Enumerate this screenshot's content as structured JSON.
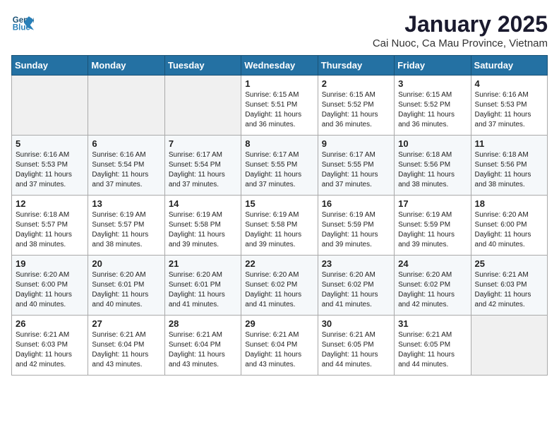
{
  "header": {
    "logo_line1": "General",
    "logo_line2": "Blue",
    "title": "January 2025",
    "subtitle": "Cai Nuoc, Ca Mau Province, Vietnam"
  },
  "weekdays": [
    "Sunday",
    "Monday",
    "Tuesday",
    "Wednesday",
    "Thursday",
    "Friday",
    "Saturday"
  ],
  "weeks": [
    [
      {
        "day": "",
        "info": ""
      },
      {
        "day": "",
        "info": ""
      },
      {
        "day": "",
        "info": ""
      },
      {
        "day": "1",
        "info": "Sunrise: 6:15 AM\nSunset: 5:51 PM\nDaylight: 11 hours\nand 36 minutes."
      },
      {
        "day": "2",
        "info": "Sunrise: 6:15 AM\nSunset: 5:52 PM\nDaylight: 11 hours\nand 36 minutes."
      },
      {
        "day": "3",
        "info": "Sunrise: 6:15 AM\nSunset: 5:52 PM\nDaylight: 11 hours\nand 36 minutes."
      },
      {
        "day": "4",
        "info": "Sunrise: 6:16 AM\nSunset: 5:53 PM\nDaylight: 11 hours\nand 37 minutes."
      }
    ],
    [
      {
        "day": "5",
        "info": "Sunrise: 6:16 AM\nSunset: 5:53 PM\nDaylight: 11 hours\nand 37 minutes."
      },
      {
        "day": "6",
        "info": "Sunrise: 6:16 AM\nSunset: 5:54 PM\nDaylight: 11 hours\nand 37 minutes."
      },
      {
        "day": "7",
        "info": "Sunrise: 6:17 AM\nSunset: 5:54 PM\nDaylight: 11 hours\nand 37 minutes."
      },
      {
        "day": "8",
        "info": "Sunrise: 6:17 AM\nSunset: 5:55 PM\nDaylight: 11 hours\nand 37 minutes."
      },
      {
        "day": "9",
        "info": "Sunrise: 6:17 AM\nSunset: 5:55 PM\nDaylight: 11 hours\nand 37 minutes."
      },
      {
        "day": "10",
        "info": "Sunrise: 6:18 AM\nSunset: 5:56 PM\nDaylight: 11 hours\nand 38 minutes."
      },
      {
        "day": "11",
        "info": "Sunrise: 6:18 AM\nSunset: 5:56 PM\nDaylight: 11 hours\nand 38 minutes."
      }
    ],
    [
      {
        "day": "12",
        "info": "Sunrise: 6:18 AM\nSunset: 5:57 PM\nDaylight: 11 hours\nand 38 minutes."
      },
      {
        "day": "13",
        "info": "Sunrise: 6:19 AM\nSunset: 5:57 PM\nDaylight: 11 hours\nand 38 minutes."
      },
      {
        "day": "14",
        "info": "Sunrise: 6:19 AM\nSunset: 5:58 PM\nDaylight: 11 hours\nand 39 minutes."
      },
      {
        "day": "15",
        "info": "Sunrise: 6:19 AM\nSunset: 5:58 PM\nDaylight: 11 hours\nand 39 minutes."
      },
      {
        "day": "16",
        "info": "Sunrise: 6:19 AM\nSunset: 5:59 PM\nDaylight: 11 hours\nand 39 minutes."
      },
      {
        "day": "17",
        "info": "Sunrise: 6:19 AM\nSunset: 5:59 PM\nDaylight: 11 hours\nand 39 minutes."
      },
      {
        "day": "18",
        "info": "Sunrise: 6:20 AM\nSunset: 6:00 PM\nDaylight: 11 hours\nand 40 minutes."
      }
    ],
    [
      {
        "day": "19",
        "info": "Sunrise: 6:20 AM\nSunset: 6:00 PM\nDaylight: 11 hours\nand 40 minutes."
      },
      {
        "day": "20",
        "info": "Sunrise: 6:20 AM\nSunset: 6:01 PM\nDaylight: 11 hours\nand 40 minutes."
      },
      {
        "day": "21",
        "info": "Sunrise: 6:20 AM\nSunset: 6:01 PM\nDaylight: 11 hours\nand 41 minutes."
      },
      {
        "day": "22",
        "info": "Sunrise: 6:20 AM\nSunset: 6:02 PM\nDaylight: 11 hours\nand 41 minutes."
      },
      {
        "day": "23",
        "info": "Sunrise: 6:20 AM\nSunset: 6:02 PM\nDaylight: 11 hours\nand 41 minutes."
      },
      {
        "day": "24",
        "info": "Sunrise: 6:20 AM\nSunset: 6:02 PM\nDaylight: 11 hours\nand 42 minutes."
      },
      {
        "day": "25",
        "info": "Sunrise: 6:21 AM\nSunset: 6:03 PM\nDaylight: 11 hours\nand 42 minutes."
      }
    ],
    [
      {
        "day": "26",
        "info": "Sunrise: 6:21 AM\nSunset: 6:03 PM\nDaylight: 11 hours\nand 42 minutes."
      },
      {
        "day": "27",
        "info": "Sunrise: 6:21 AM\nSunset: 6:04 PM\nDaylight: 11 hours\nand 43 minutes."
      },
      {
        "day": "28",
        "info": "Sunrise: 6:21 AM\nSunset: 6:04 PM\nDaylight: 11 hours\nand 43 minutes."
      },
      {
        "day": "29",
        "info": "Sunrise: 6:21 AM\nSunset: 6:04 PM\nDaylight: 11 hours\nand 43 minutes."
      },
      {
        "day": "30",
        "info": "Sunrise: 6:21 AM\nSunset: 6:05 PM\nDaylight: 11 hours\nand 44 minutes."
      },
      {
        "day": "31",
        "info": "Sunrise: 6:21 AM\nSunset: 6:05 PM\nDaylight: 11 hours\nand 44 minutes."
      },
      {
        "day": "",
        "info": ""
      }
    ]
  ]
}
